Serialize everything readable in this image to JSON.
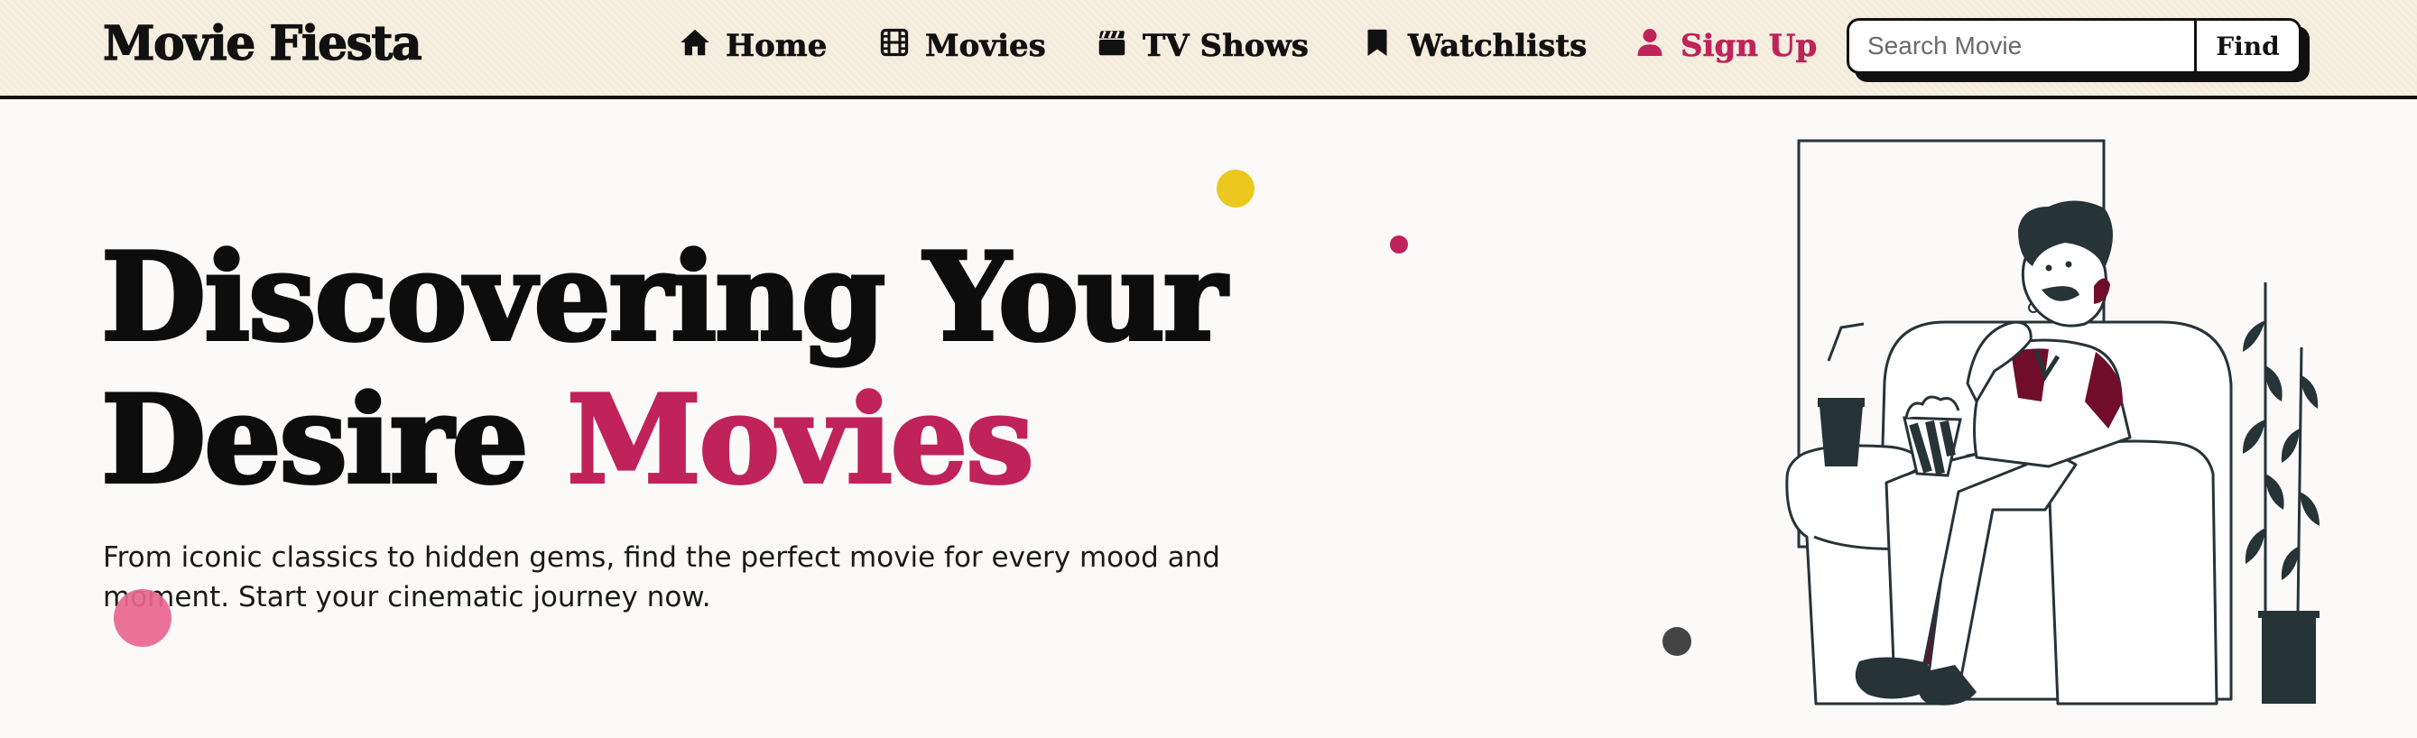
{
  "brand": {
    "name": "Movie Fiesta"
  },
  "nav": {
    "items": [
      {
        "label": "Home",
        "icon": "home-icon"
      },
      {
        "label": "Movies",
        "icon": "film-icon"
      },
      {
        "label": "TV Shows",
        "icon": "clapperboard-icon"
      },
      {
        "label": "Watchlists",
        "icon": "bookmark-icon"
      },
      {
        "label": "Sign Up",
        "icon": "user-icon"
      }
    ]
  },
  "search": {
    "placeholder": "Search Movie",
    "value": "",
    "button_label": "Find"
  },
  "hero": {
    "title_line1": "Discovering Your",
    "title_line2_plain": "Desire",
    "title_line2_accent": "Movies",
    "subtitle": "From iconic classics to hidden gems, find the perfect movie for every mood and moment. Start your cinematic journey now."
  },
  "colors": {
    "accent": "#c0225a",
    "nav_background": "#f6efe0",
    "page_background": "#fbfaf8",
    "dot_yellow": "#ecc81f",
    "dot_pink": "#e8668f",
    "dot_dark": "#444444",
    "illustration_dark": "#263337",
    "illustration_maroon": "#6f0d2b"
  }
}
